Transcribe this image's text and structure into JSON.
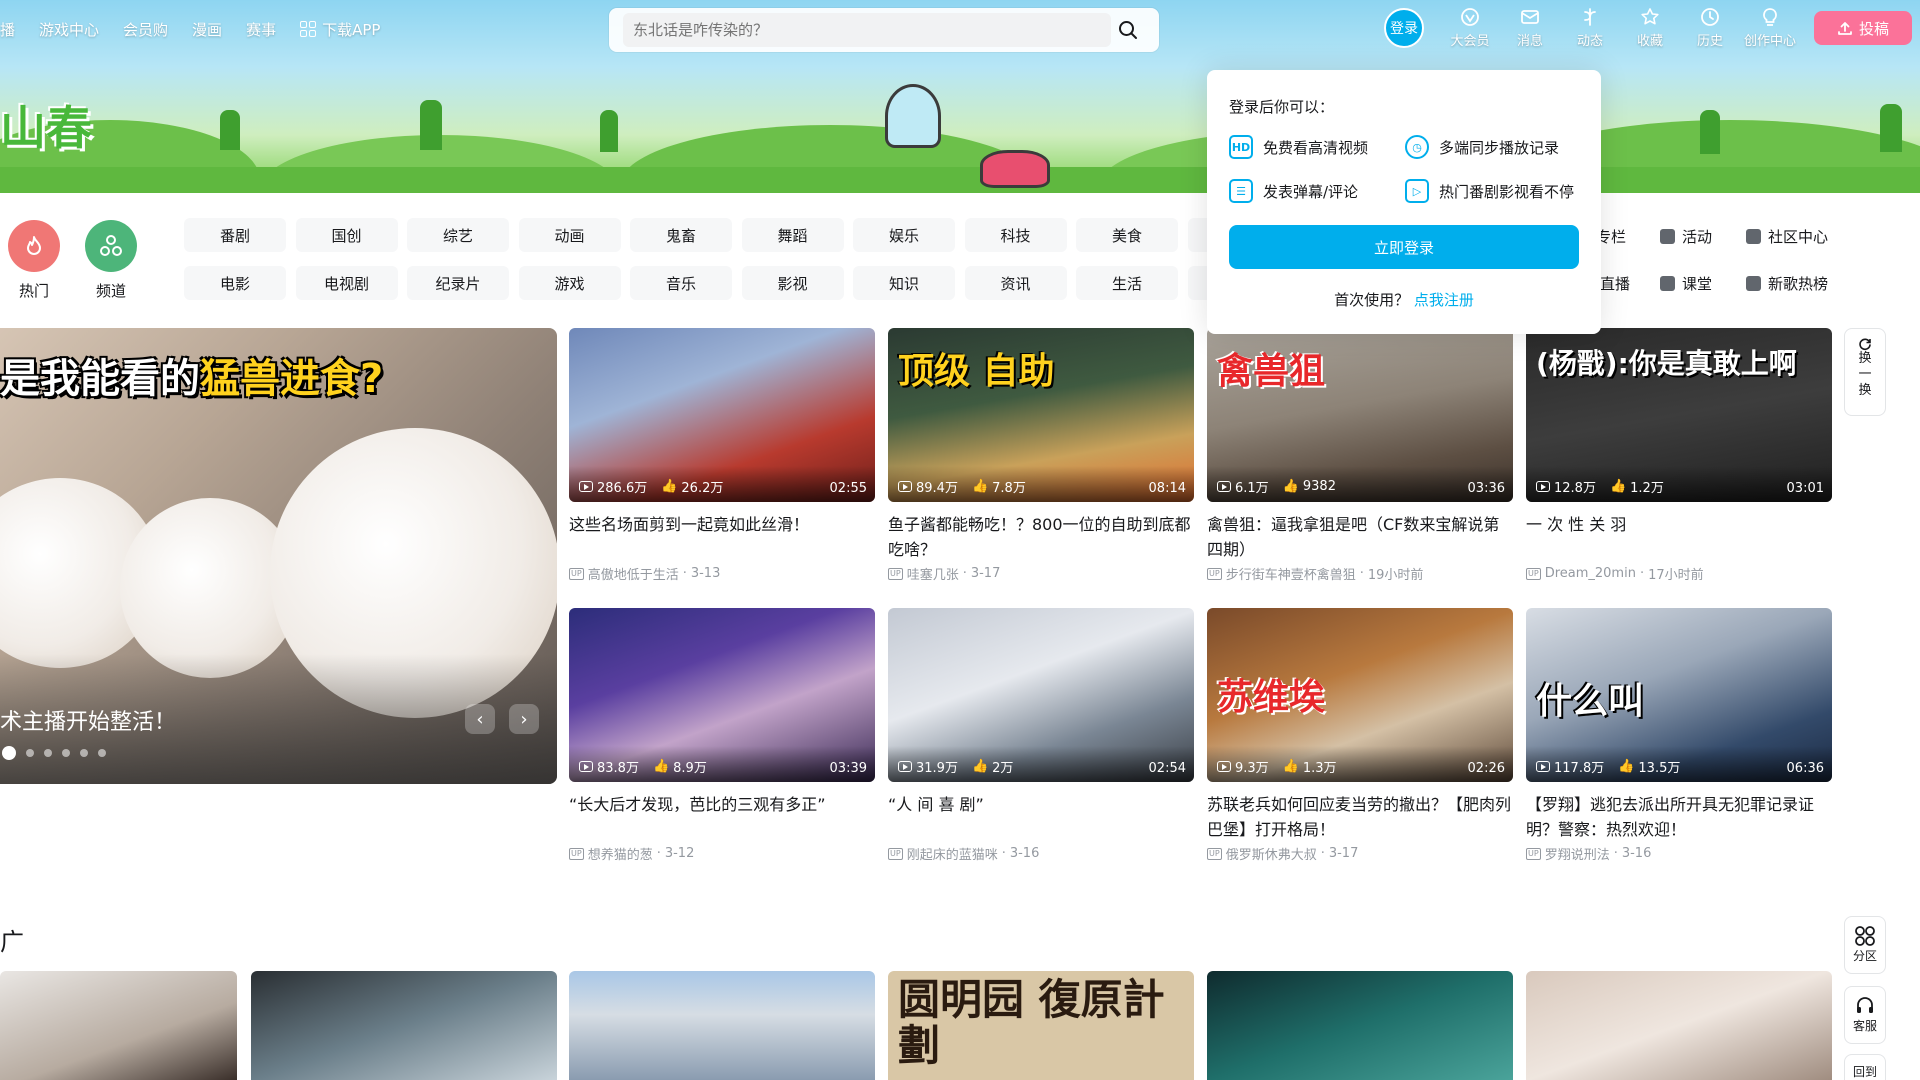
{
  "topnav": {
    "items": [
      "播",
      "游戏中心",
      "会员购",
      "漫画",
      "赛事"
    ],
    "download_app": "下载APP"
  },
  "search": {
    "placeholder": "东北话是咋传染的？"
  },
  "user_nav": {
    "login": "登录",
    "items": [
      "大会员",
      "消息",
      "动态",
      "收藏",
      "历史",
      "创作中心"
    ],
    "upload": "投稿"
  },
  "banner": {
    "logo_text": "山春"
  },
  "main_channels": [
    {
      "label": "热门",
      "color": "#f07775"
    },
    {
      "label": "频道",
      "color": "#4db57a"
    }
  ],
  "channels": [
    "番剧",
    "国创",
    "综艺",
    "动画",
    "鬼畜",
    "舞蹈",
    "娱乐",
    "科技",
    "美食",
    "电影",
    "电视剧",
    "纪录片",
    "游戏",
    "音乐",
    "影视",
    "知识",
    "资讯",
    "生活"
  ],
  "extra_channels": [
    "专栏",
    "活动",
    "社区中心",
    "直播",
    "课堂",
    "新歌热榜"
  ],
  "login_popover": {
    "title": "登录后你可以：",
    "features": [
      "免费看高清视频",
      "多端同步播放记录",
      "发表弹幕/评论",
      "热门番剧影视看不停"
    ],
    "button": "立即登录",
    "register_prompt": "首次使用？",
    "register_link": "点我注册"
  },
  "carousel": {
    "headline_prefix": "是我能看的",
    "headline_highlight": "猛兽进食?",
    "caption": "术主播开始整活！",
    "prev": "‹",
    "next": "›"
  },
  "videos": [
    {
      "title": "这些名场面剪到一起竟如此丝滑！",
      "views": "286.6万",
      "likes": "26.2万",
      "duration": "02:55",
      "author": "高傲地低于生活",
      "date": "3-13",
      "overlay": ""
    },
    {
      "title": "鱼子酱都能畅吃！？800一位的自助到底都吃啥？",
      "views": "89.4万",
      "likes": "7.8万",
      "duration": "08:14",
      "author": "哇塞几张",
      "date": "3-17",
      "overlay": "顶级 自助"
    },
    {
      "title": "禽兽狙：逼我拿狙是吧（CF数来宝解说第四期）",
      "views": "6.1万",
      "likes": "9382",
      "duration": "03:36",
      "author": "步行街车神壹杯禽兽狙",
      "date": "19小时前",
      "overlay": "禽兽狙"
    },
    {
      "title": "一 次 性 关 羽",
      "views": "12.8万",
      "likes": "1.2万",
      "duration": "03:01",
      "author": "Dream_20min",
      "date": "17小时前",
      "overlay": "(杨戬):你是真敢上啊"
    },
    {
      "title": "“长大后才发现，芭比的三观有多正”",
      "views": "83.8万",
      "likes": "8.9万",
      "duration": "03:39",
      "author": "想养猫的葱",
      "date": "3-12",
      "overlay": ""
    },
    {
      "title": "“人 间 喜 剧”",
      "views": "31.9万",
      "likes": "2万",
      "duration": "02:54",
      "author": "刚起床的蓝猫咪",
      "date": "3-16",
      "overlay": ""
    },
    {
      "title": "苏联老兵如何回应麦当劳的撤出？【肥肉列巴堡】打开格局！",
      "views": "9.3万",
      "likes": "1.3万",
      "duration": "02:26",
      "author": "俄罗斯休弗大叔",
      "date": "3-17",
      "overlay": "苏维埃"
    },
    {
      "title": "【罗翔】逃犯去派出所开具无犯罪记录证明？警察：热烈欢迎！",
      "views": "117.8万",
      "likes": "13.5万",
      "duration": "06:36",
      "author": "罗翔说刑法",
      "date": "3-16",
      "overlay": "什么叫"
    }
  ],
  "side": {
    "refresh": [
      "换",
      "一",
      "换"
    ],
    "zone": "分区",
    "service": "客服",
    "back_top": "回到"
  },
  "promo": {
    "section_title": "广",
    "tile_text": "圆明园 復原計劃"
  }
}
